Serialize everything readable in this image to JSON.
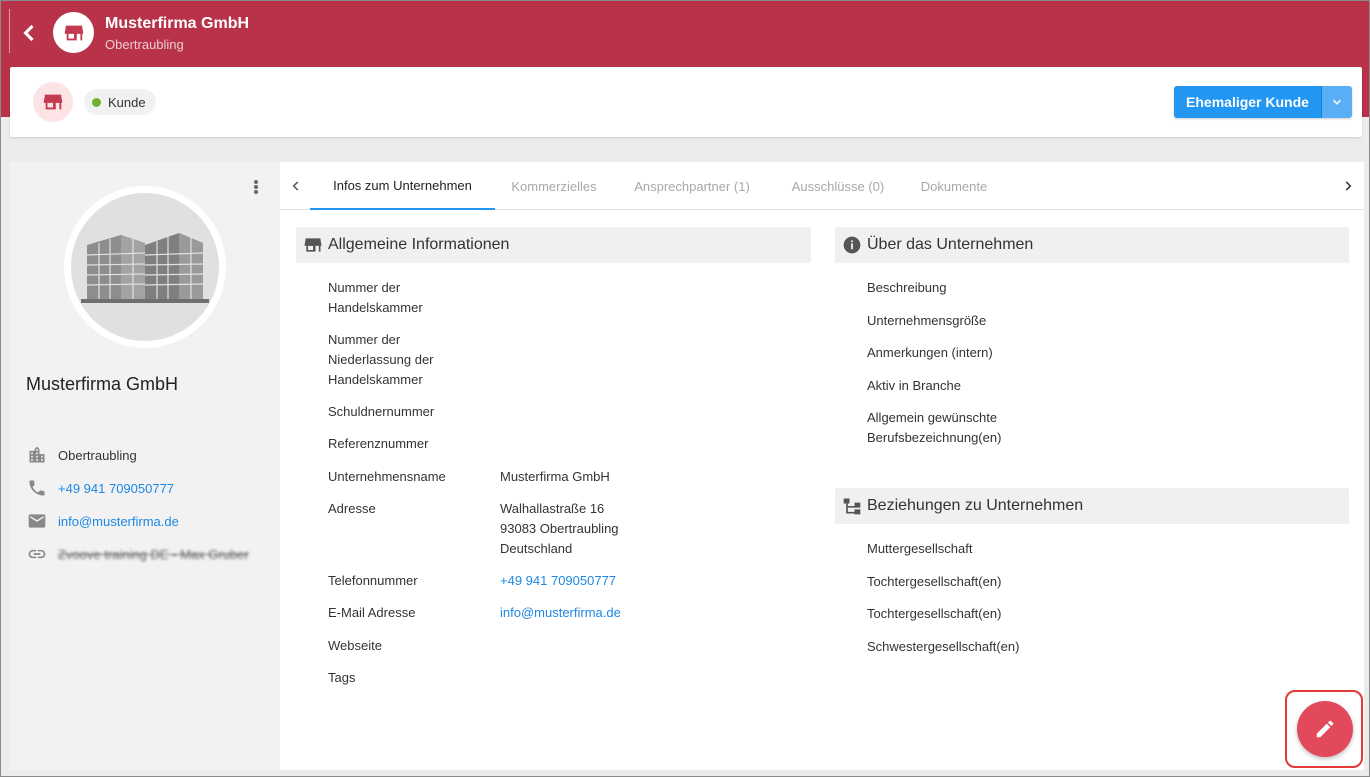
{
  "topbar": {
    "title": "Musterfirma GmbH",
    "subtitle": "Obertraubling",
    "back_icon": "chevron-left-icon",
    "avatar_icon": "store-icon",
    "color": "#b8334a"
  },
  "header_card": {
    "avatar_icon": "store-icon",
    "status_label": "Kunde",
    "status_color": "#6fb233",
    "action_button_label": "Ehemaliger Kunde",
    "action_button_color": "#2196f3",
    "dropdown_icon": "chevron-down-icon"
  },
  "profile": {
    "name": "Musterfirma GmbH",
    "city": "Obertraubling",
    "phone": "+49 941 709050777",
    "email": "info@musterfirma.de",
    "link_text": "Zvoove training DE - Max Gruber"
  },
  "tabs": [
    {
      "label": "Infos zum Unternehmen",
      "active": true
    },
    {
      "label": "Kommerzielles",
      "active": false
    },
    {
      "label": "Ansprechpartner (1)",
      "active": false
    },
    {
      "label": "Ausschlüsse (0)",
      "active": false
    },
    {
      "label": "Dokumente",
      "active": false
    }
  ],
  "general_info": {
    "title": "Allgemeine Informationen",
    "fields": [
      {
        "label": "Nummer der Handelskammer",
        "value": ""
      },
      {
        "label": "Nummer der Niederlassung der Handelskammer",
        "value": ""
      },
      {
        "label": "Schuldnernummer",
        "value": ""
      },
      {
        "label": "Referenznummer",
        "value": ""
      },
      {
        "label": "Unternehmensname",
        "value": "Musterfirma GmbH"
      },
      {
        "label": "Adresse",
        "value_lines": [
          "Walhallastraße 16",
          "93083 Obertraubling",
          "Deutschland"
        ]
      },
      {
        "label": "Telefonnummer",
        "value": "+49 941 709050777"
      },
      {
        "label": "E-Mail Adresse",
        "value": "info@musterfirma.de"
      },
      {
        "label": "Webseite",
        "value": ""
      },
      {
        "label": "Tags",
        "value": ""
      }
    ]
  },
  "about": {
    "title": "Über das Unternehmen",
    "fields": [
      "Beschreibung",
      "Unternehmensgröße",
      "Anmerkungen (intern)",
      "Aktiv in Branche",
      "Allgemein gewünschte Berufsbezeichnung(en)"
    ]
  },
  "relations": {
    "title": "Beziehungen zu Unternehmen",
    "fields": [
      "Muttergesellschaft",
      "Tochtergesellschaft(en)",
      "Tochtergesellschaft(en)",
      "Schwestergesellschaft(en)"
    ]
  },
  "fab": {
    "icon": "pencil-icon",
    "color": "#e24a5b"
  }
}
